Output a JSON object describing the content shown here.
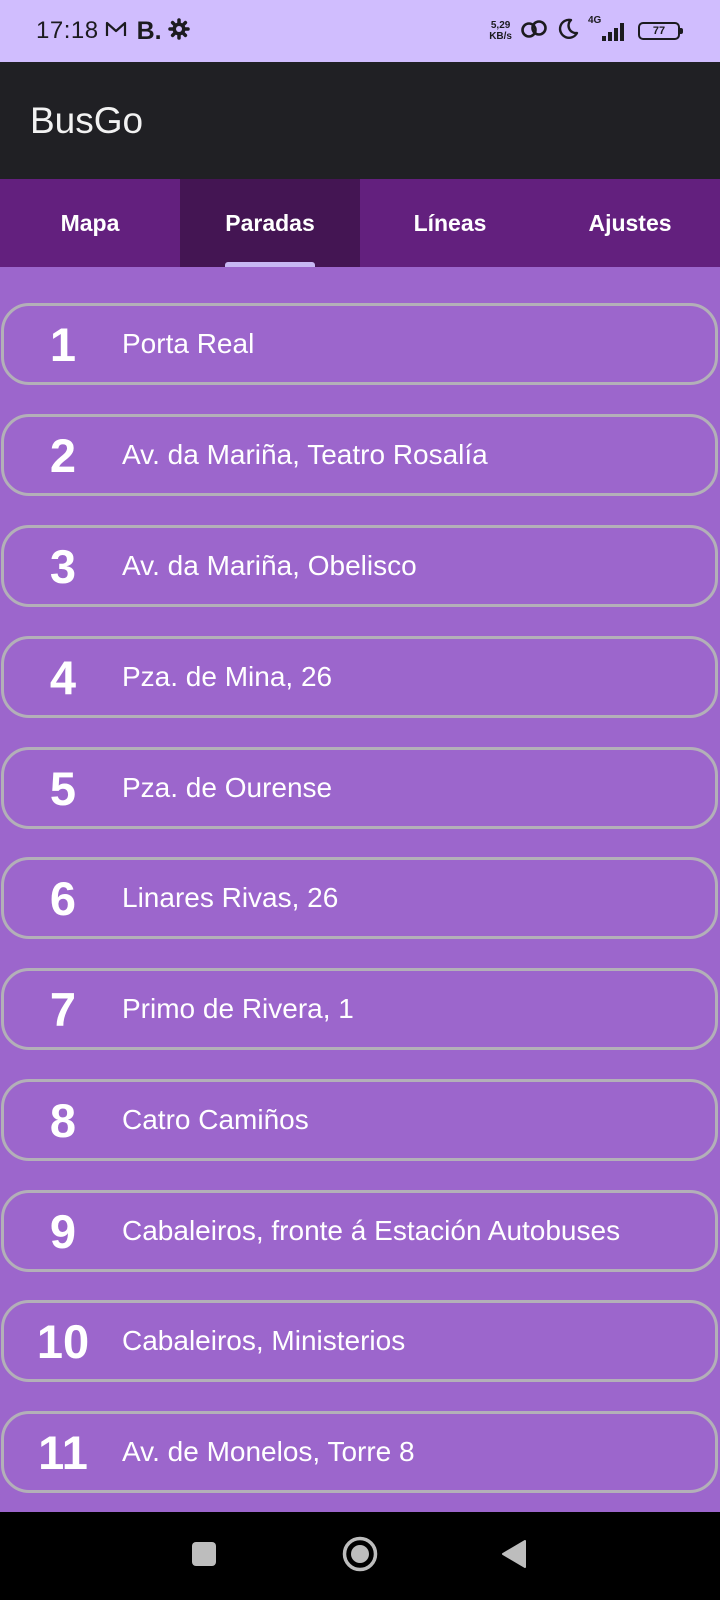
{
  "status_bar": {
    "time": "17:18",
    "b_label": "B.",
    "speed_value": "5,29",
    "speed_unit": "KB/s",
    "network": "4G",
    "battery": "77",
    "icons": [
      "mail-icon",
      "settings-icon",
      "sync-icon",
      "moon-icon",
      "signal-icon",
      "battery-icon"
    ]
  },
  "app": {
    "title": "BusGo"
  },
  "tabs": [
    {
      "label": "Mapa",
      "active": false
    },
    {
      "label": "Paradas",
      "active": true
    },
    {
      "label": "Líneas",
      "active": false
    },
    {
      "label": "Ajustes",
      "active": false
    }
  ],
  "stops": [
    {
      "number": "1",
      "name": "Porta Real"
    },
    {
      "number": "2",
      "name": "Av. da Mariña, Teatro Rosalía"
    },
    {
      "number": "3",
      "name": "Av. da Mariña, Obelisco"
    },
    {
      "number": "4",
      "name": "Pza. de Mina, 26"
    },
    {
      "number": "5",
      "name": "Pza. de Ourense"
    },
    {
      "number": "6",
      "name": "Linares Rivas, 26"
    },
    {
      "number": "7",
      "name": "Primo de Rivera, 1"
    },
    {
      "number": "8",
      "name": "Catro Camiños"
    },
    {
      "number": "9",
      "name": "Cabaleiros, fronte á Estación Autobuses"
    },
    {
      "number": "10",
      "name": "Cabaleiros, Ministerios"
    },
    {
      "number": "11",
      "name": "Av. de Monelos, Torre 8"
    }
  ],
  "nav_bar": {
    "buttons": [
      "recents-icon",
      "home-icon",
      "back-icon"
    ]
  },
  "colors": {
    "status_bar": "#d0bdfe",
    "app_bar": "#202024",
    "tab_bar": "#63207e",
    "tab_active": "#441553",
    "tab_indicator": "#c8b8f4",
    "background": "#9c66cc",
    "item_border": "#b3b0b8"
  }
}
